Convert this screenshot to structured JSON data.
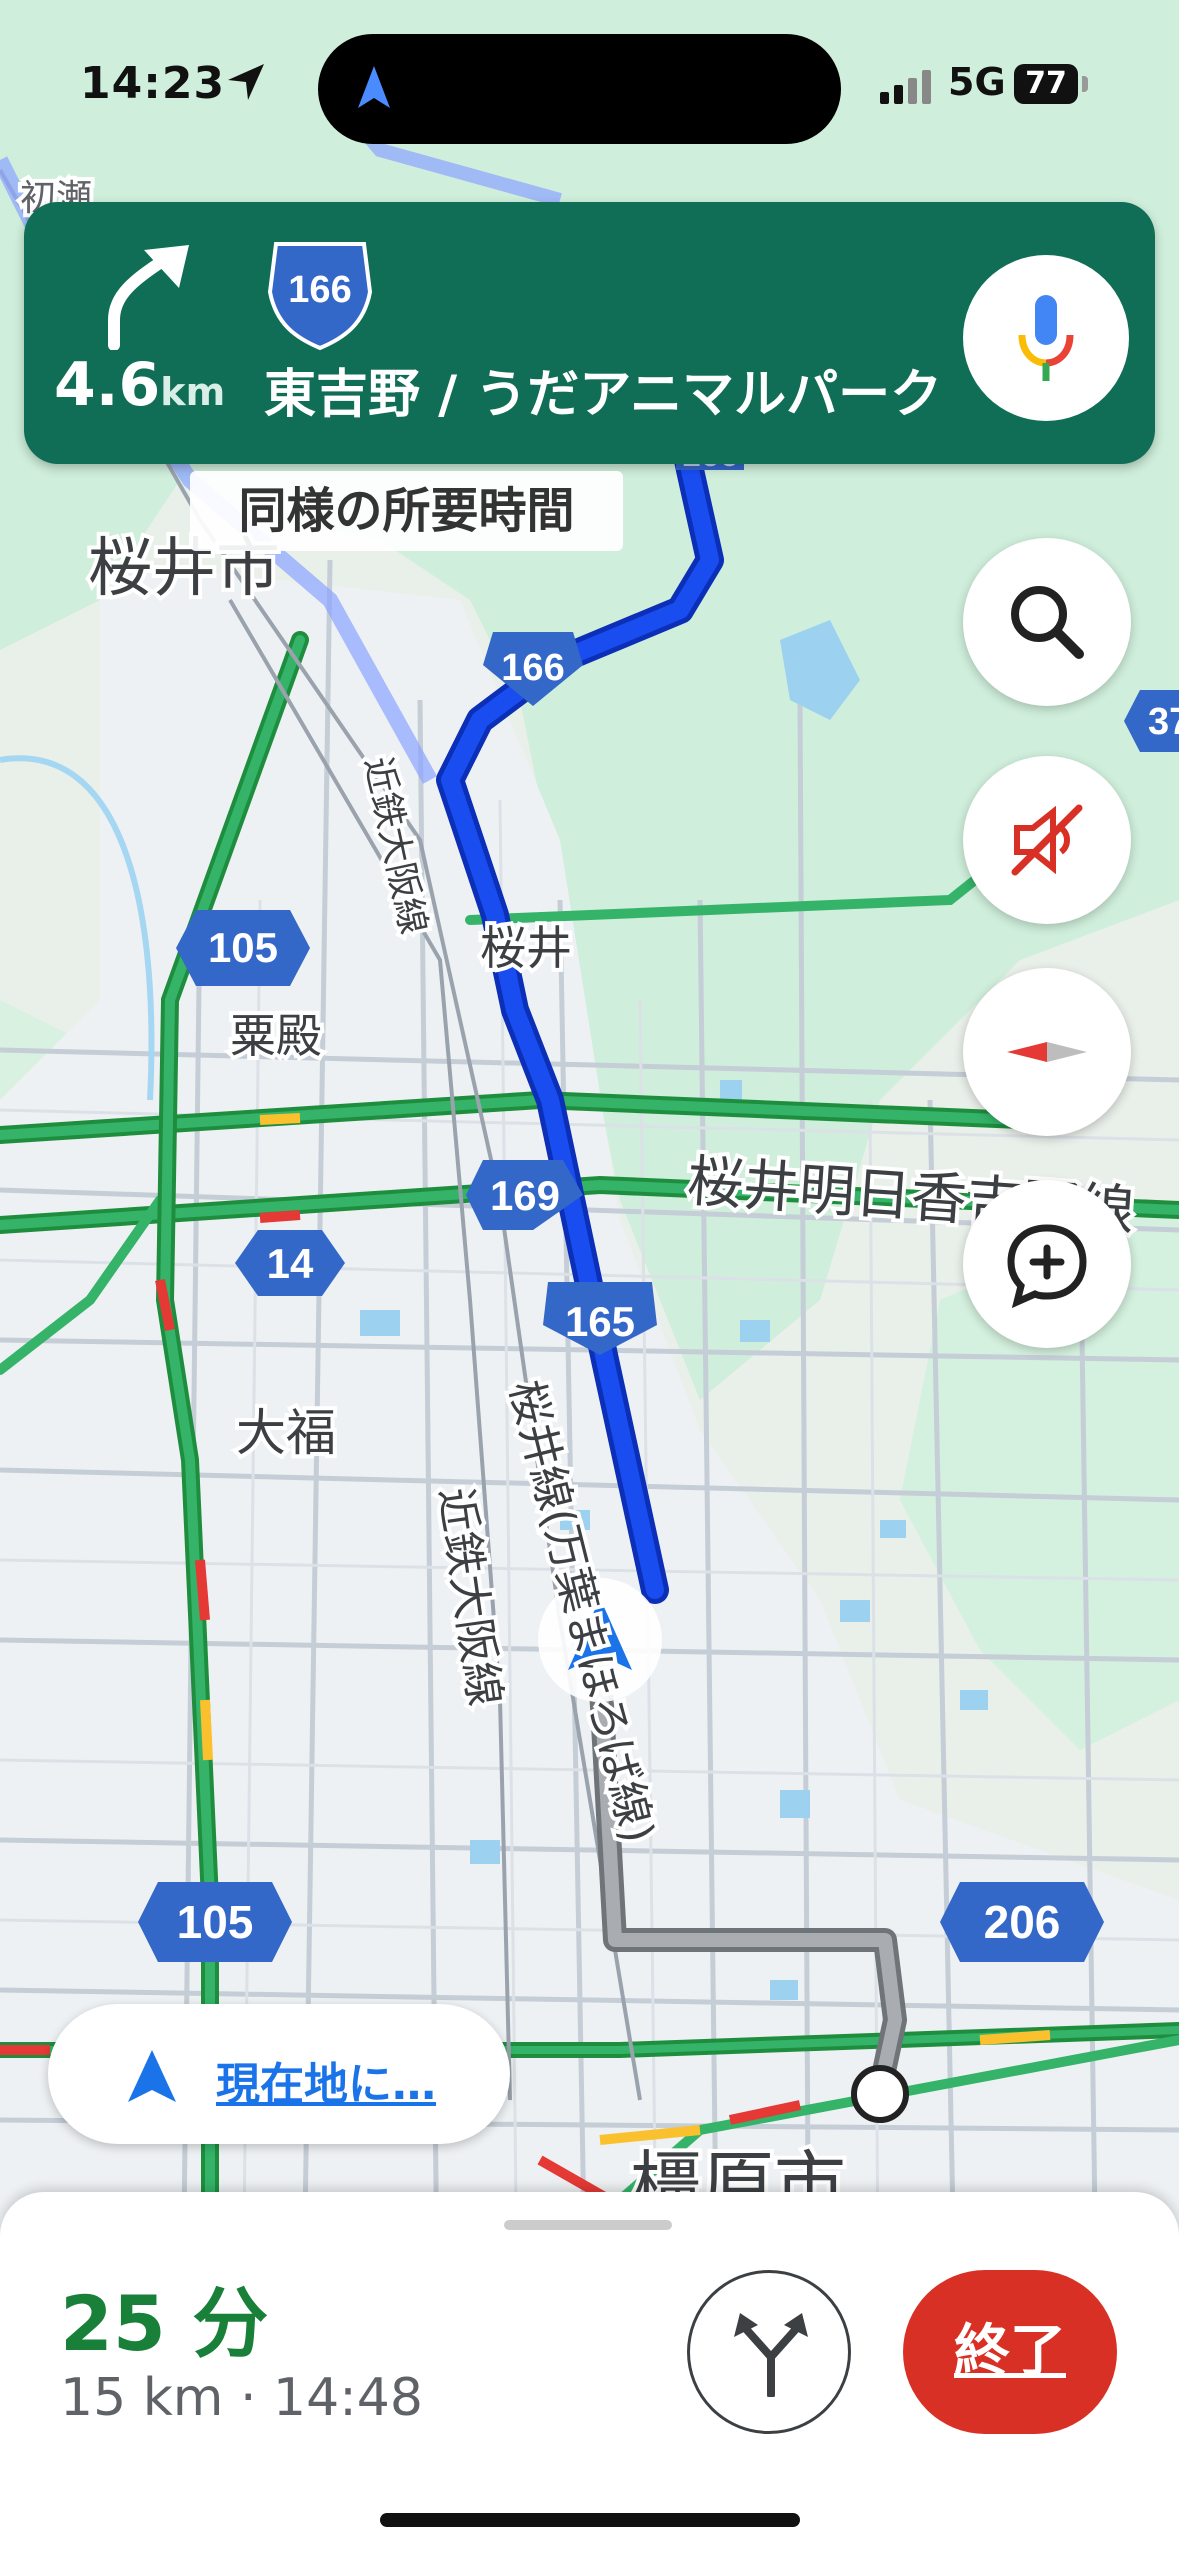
{
  "status_bar": {
    "time": "14:23",
    "network": "5G",
    "battery": "77"
  },
  "banner": {
    "route_number": "166",
    "distance": "4.6",
    "distance_unit": "km",
    "destination": "東吉野 / うだアニマルパーク"
  },
  "chip_similar_time": "同様の所要時間",
  "map_labels": {
    "city_sakurai": "桜井市",
    "district_sakurai": "桜井",
    "district_kurido": "粟殿",
    "district_daifuku": "大福",
    "rail_kintetsu_1": "近鉄大阪線",
    "rail_kintetsu_2": "近鉄大阪線",
    "road_sakurai_asuka": "桜井明日香吉野線",
    "road_sakurai_line": "桜井線(万葉まほろば線)",
    "city_kashihara": "橿原市",
    "partial_top_left": "初瀬",
    "route_166_a": "166",
    "route_166_b": "166",
    "route_105_a": "105",
    "route_105_b": "105",
    "route_14": "14",
    "route_169": "169",
    "route_165": "165",
    "route_206": "206",
    "route_37_partial": "37"
  },
  "relocate": {
    "label": "現在地に…"
  },
  "sheet": {
    "eta_duration": "25 分",
    "distance_arrival": "15 km · 14:48",
    "exit_label": "終了"
  },
  "colors": {
    "route_blue": "#1a4df0",
    "banner_green": "#0f6e55",
    "exit_red": "#d93025",
    "eta_green": "#188038",
    "shield_blue": "#3367c8"
  }
}
